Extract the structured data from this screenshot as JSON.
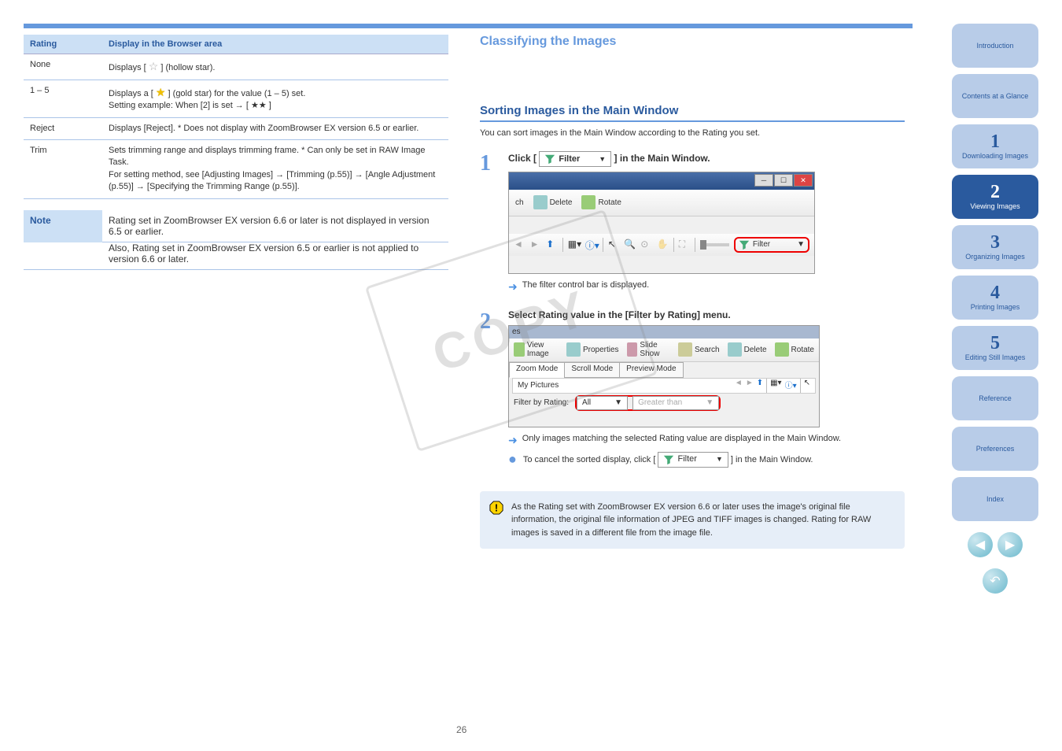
{
  "header": {
    "title": "Classifying the Images"
  },
  "table": {
    "col1": "Rating",
    "col2": "Display in the Browser area",
    "rows": [
      {
        "rating": "None",
        "desc_prefix": "Displays [ ",
        "desc_suffix": " ] (hollow star)."
      },
      {
        "rating": "1 – 5",
        "desc_prefix": "Displays a [ ",
        "desc_mid": " ] (gold star) for the value (1 – 5) set.",
        "desc_extra_label": "Setting example: ",
        "desc_extra": "When [2] is set → [ ★★ ]"
      },
      {
        "rating": "Reject",
        "desc": "Displays [Reject].                                                                     * Does not display with ZoomBrowser EX version 6.5 or earlier."
      },
      {
        "rating": "Trim",
        "desc": "Sets trimming range and displays trimming frame.                          * Can only be set in RAW Image Task.",
        "extra_label": "For setting method, see ",
        "extra_steps": "[Adjusting Images] → [Trimming (p.55)] → [Angle Adjustment (p.55)] → [Specifying the Trimming Range (p.55)]."
      }
    ]
  },
  "note": {
    "label": "Note",
    "line1": "Rating set in ZoomBrowser EX version 6.6 or later is not displayed in version 6.5 or earlier.",
    "line2": "Also, Rating set in ZoomBrowser EX version 6.5 or earlier is not applied to version 6.6 or later."
  },
  "right": {
    "section_title": "Sorting Images in the Main Window",
    "section_desc": "You can sort images in the Main Window according to the Rating you set.",
    "step1": {
      "prefix": "Click [ ",
      "suffix": " ] in the Main Window."
    },
    "filter_label": "Filter",
    "ss1": {
      "toolbar": {
        "delete": "Delete",
        "rotate": "Rotate",
        "ch": "ch"
      },
      "filter": "Filter"
    },
    "arrow1": "The filter control bar is displayed.",
    "step2": {
      "text": "Select Rating value in the [Filter by Rating] menu."
    },
    "ss2": {
      "titlebar": "es",
      "toolbar": {
        "view": "View Image",
        "props": "Properties",
        "slideshow": "Slide Show",
        "search": "Search",
        "delete": "Delete",
        "rotate": "Rotate"
      },
      "tabs": {
        "zoom": "Zoom Mode",
        "scroll": "Scroll Mode",
        "preview": "Preview Mode"
      },
      "path": "My Pictures",
      "filter_label": "Filter by Rating:",
      "dd1": "All",
      "dd2": "Greater than"
    },
    "arrow2": "Only images matching the selected Rating value are displayed in the Main Window.",
    "bullet": {
      "prefix": "To cancel the sorted display, click [ ",
      "suffix": " ] in the Main Window."
    }
  },
  "warning": {
    "text": "As the Rating set with ZoomBrowser EX version 6.6 or later uses the image's original file information, the original file information of JPEG and TIFF images is changed. Rating for RAW images is saved in a different file from the image file."
  },
  "sidenav": {
    "items": [
      {
        "num": "",
        "label": "Introduction"
      },
      {
        "num": "",
        "label": "Contents at a Glance"
      },
      {
        "num": "1",
        "label": "Downloading Images"
      },
      {
        "num": "2",
        "label": "Viewing Images"
      },
      {
        "num": "3",
        "label": "Organizing Images"
      },
      {
        "num": "4",
        "label": "Printing Images"
      },
      {
        "num": "5",
        "label": "Editing Still Images"
      },
      {
        "num": "",
        "label": "Reference"
      },
      {
        "num": "",
        "label": "Preferences"
      },
      {
        "num": "",
        "label": "Index"
      }
    ]
  },
  "copy_stamp": "COPY",
  "page_number": "26"
}
